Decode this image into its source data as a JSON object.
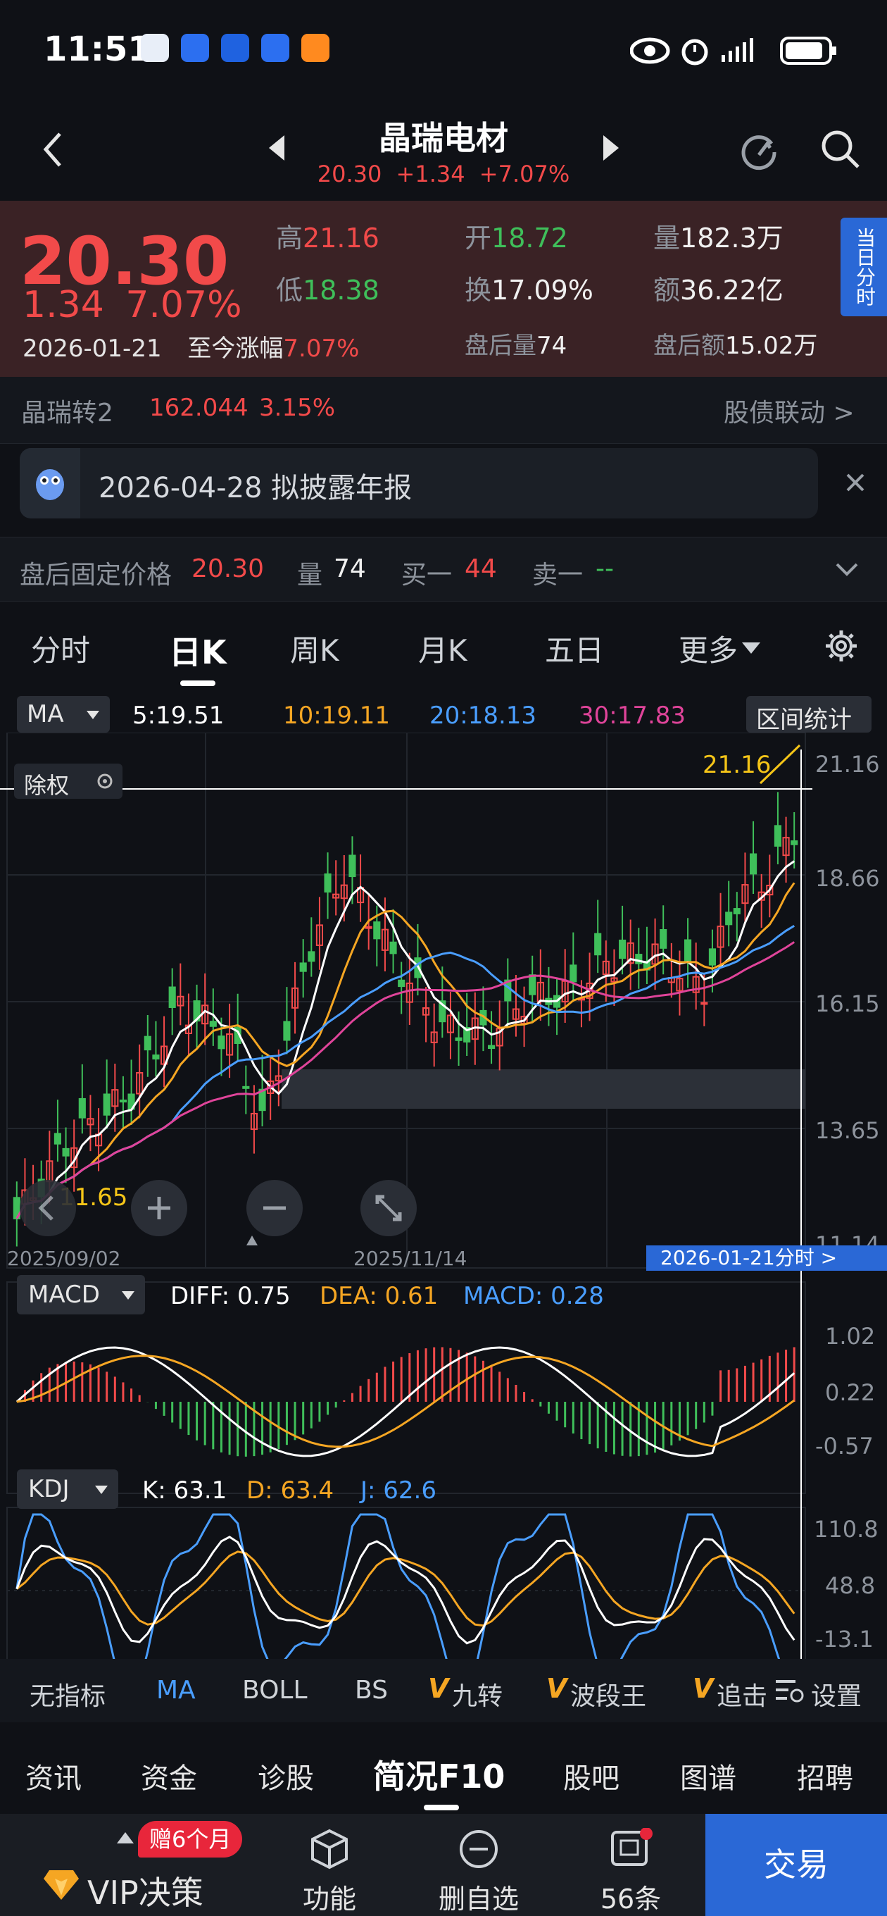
{
  "status": {
    "time": "11:51"
  },
  "header": {
    "title": "晶瑞电材",
    "price": "20.30",
    "change": "+1.34",
    "change_pct": "+7.07%"
  },
  "quote": {
    "price": "20.30",
    "change": "1.34",
    "change_pct": "7.07%",
    "date": "2026-01-21",
    "since_label": "至今涨幅",
    "since_value": "7.07%",
    "high_label": "高",
    "high": "21.16",
    "low_label": "低",
    "low": "18.38",
    "open_label": "开",
    "open": "18.72",
    "turnover_label": "换",
    "turnover": "17.09%",
    "after_vol_label": "盘后量",
    "after_vol": "74",
    "vol_label": "量",
    "vol": "182.3万",
    "amount_label": "额",
    "amount": "36.22亿",
    "after_amount_label": "盘后额",
    "after_amount": "15.02万",
    "side_tab": "当日分时"
  },
  "bond": {
    "name": "晶瑞转2",
    "price": "162.044",
    "pct": "3.15%",
    "link": "股债联动 >"
  },
  "notice": {
    "text": "2026-04-28 拟披露年报"
  },
  "after_hours": {
    "label": "盘后固定价格",
    "price": "20.30",
    "vol_label": "量",
    "vol": "74",
    "buy_label": "买一",
    "buy": "44",
    "sell_label": "卖一",
    "sell": "--"
  },
  "tabs": [
    "分时",
    "日K",
    "周K",
    "月K",
    "五日",
    "更多"
  ],
  "ma_row": {
    "selector": "MA",
    "ma5": "5:19.51",
    "ma10": "10:19.11",
    "ma20": "20:18.13",
    "ma30": "30:17.83",
    "range_btn": "区间统计"
  },
  "chart_labels": {
    "fuquan": "除权",
    "high_mark": "21.16",
    "low_mark": "11.65",
    "y_ticks": [
      "21.16",
      "18.66",
      "16.15",
      "13.65",
      "11.14"
    ],
    "date_left": "2025/09/02",
    "date_mid": "2025/11/14",
    "crosshair_tag": "2026-01-21分时 >"
  },
  "macd": {
    "selector": "MACD",
    "diff": "DIFF: 0.75",
    "dea": "DEA: 0.61",
    "macd": "MACD: 0.28",
    "ticks": [
      "1.02",
      "0.22",
      "-0.57"
    ]
  },
  "kdj": {
    "selector": "KDJ",
    "k": "K: 63.1",
    "d": "D: 63.4",
    "j": "J: 62.6",
    "ticks": [
      "110.8",
      "48.8",
      "-13.1"
    ]
  },
  "indicators": [
    "无指标",
    "MA",
    "BOLL",
    "BS",
    "九转",
    "波段王",
    "追击"
  ],
  "indicator_settings": "设置",
  "subnav": [
    "资讯",
    "资金",
    "诊股",
    "简况F10",
    "股吧",
    "图谱",
    "招聘"
  ],
  "bottom": {
    "vip": "VIP决策",
    "badge": "赠6个月",
    "func": "功能",
    "remove": "删自选",
    "ask": "56条",
    "trade": "交易"
  },
  "colors": {
    "up": "#f24a4a",
    "down": "#3fbf5a",
    "ma5": "#ffffff",
    "ma10": "#f5a623",
    "ma20": "#4a9eff",
    "ma30": "#e0449a",
    "trade_bg": "#2a68d6"
  }
}
